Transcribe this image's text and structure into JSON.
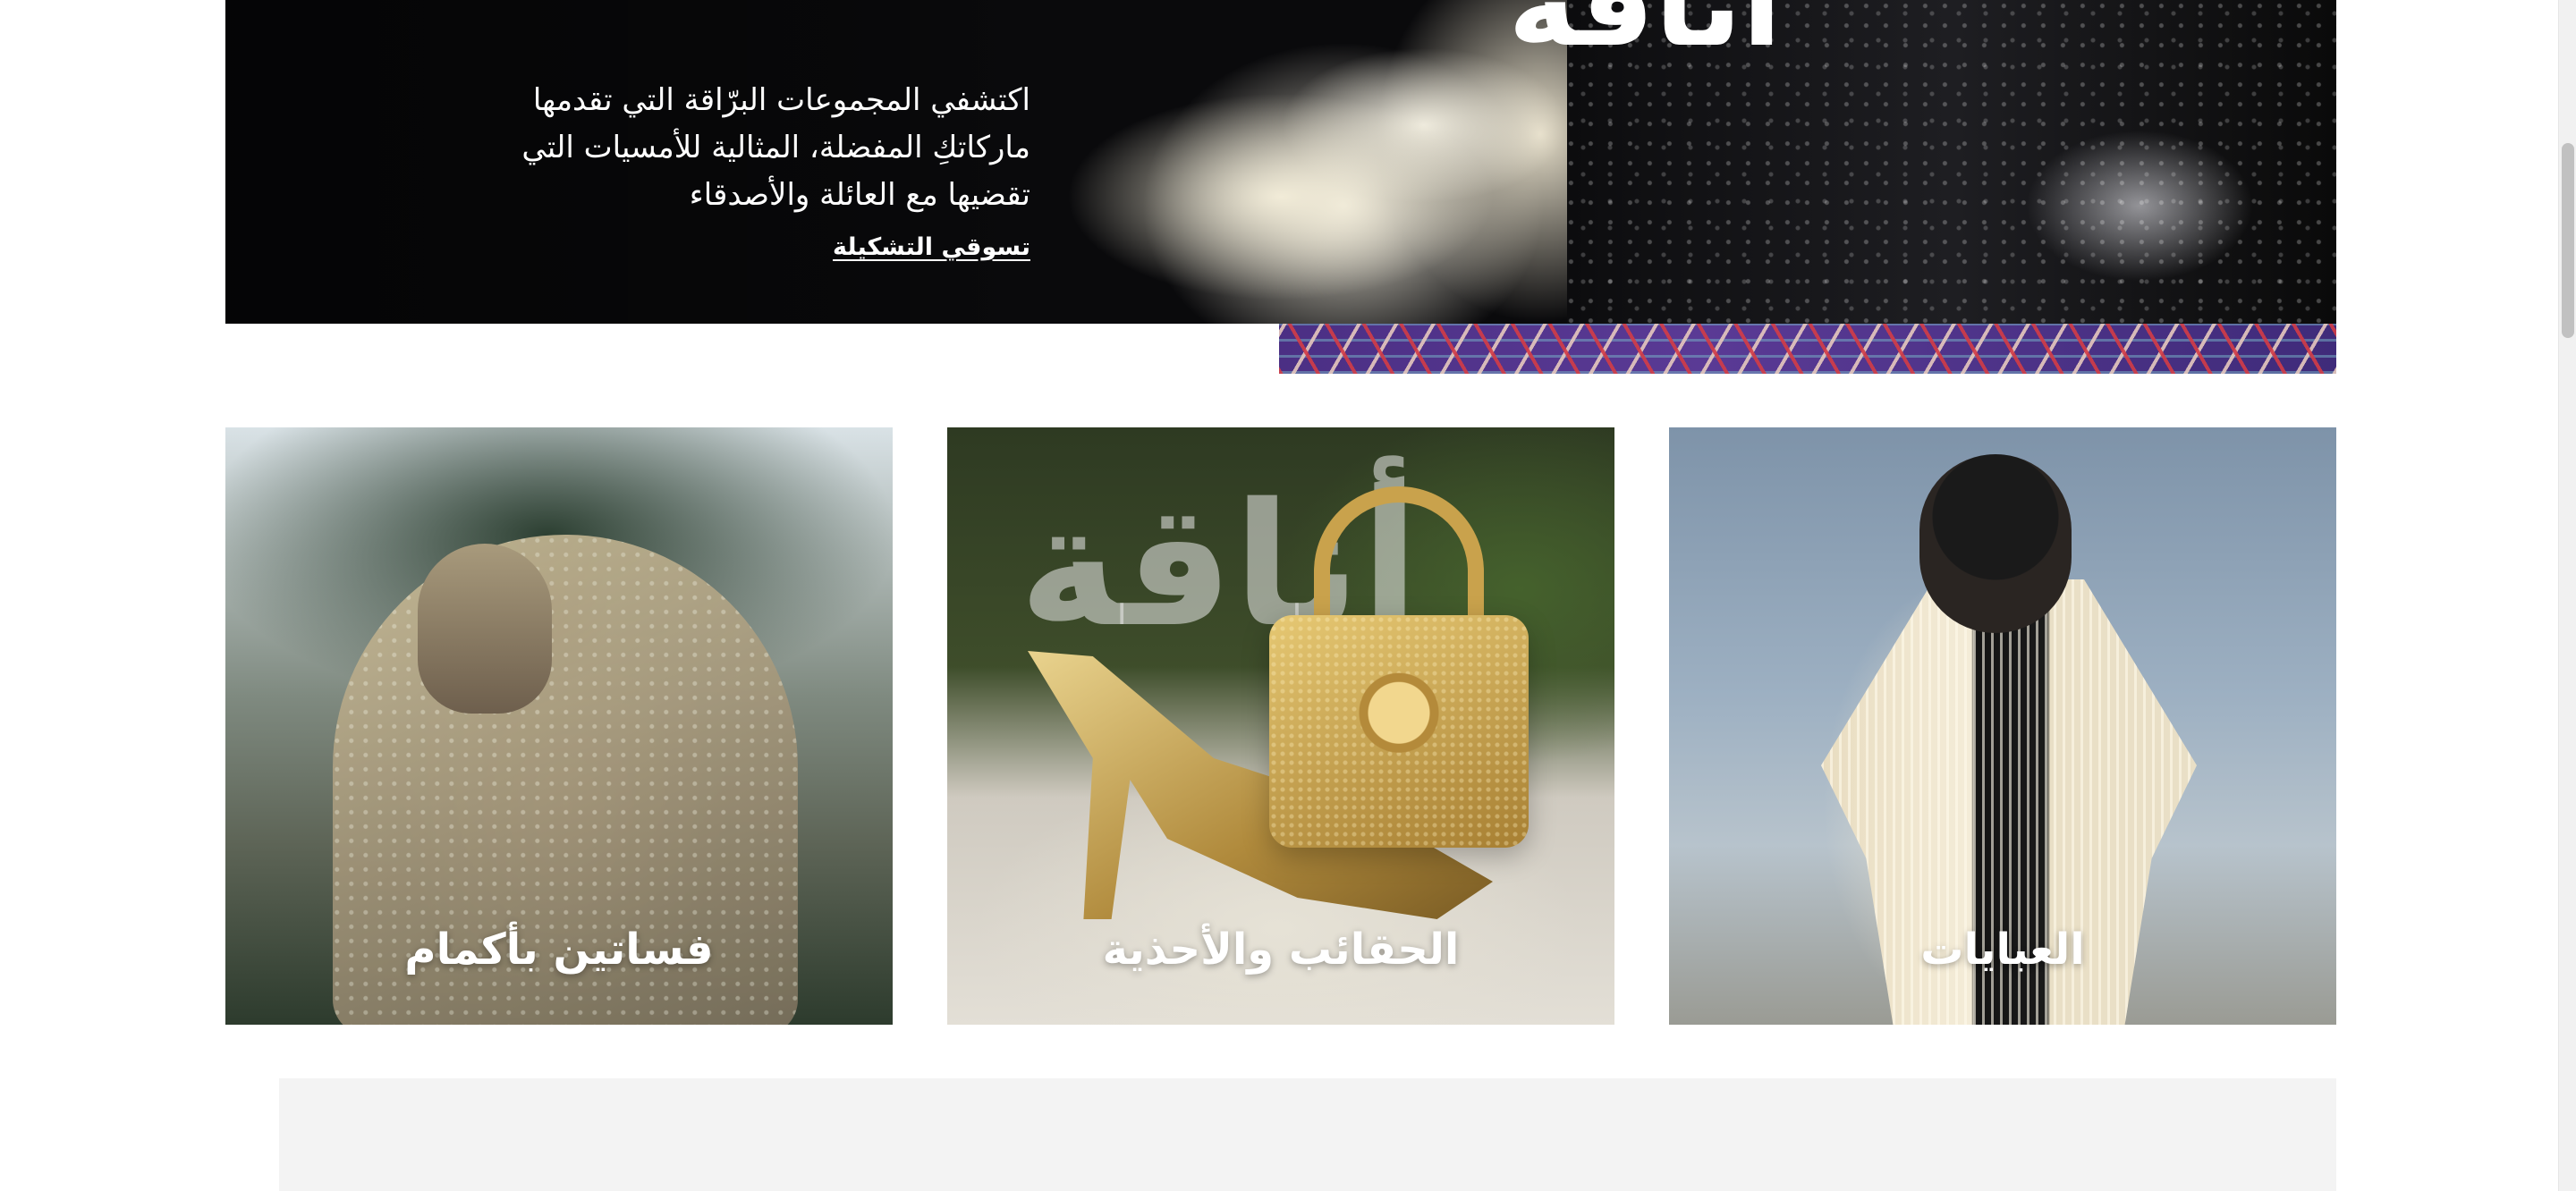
{
  "hero": {
    "title_fragment": "أناقة",
    "description": "اكتشفي المجموعات البرّاقة التي تقدمها ماركاتكِ المفضلة، المثالية للأمسيات التي تقضيها مع العائلة والأصدقاء",
    "cta_label": "تسوقي التشكيلة"
  },
  "categories": [
    {
      "label": "فساتين بأكمام"
    },
    {
      "label": "الحقائب والأحذية",
      "image_overlay_text": "أناقة"
    },
    {
      "label": "العبايات"
    }
  ],
  "colors": {
    "background": "#ffffff",
    "text_on_image": "#ffffff",
    "grey_block": "#f3f3f3",
    "scrollbar_thumb": "#c1c1c1"
  }
}
